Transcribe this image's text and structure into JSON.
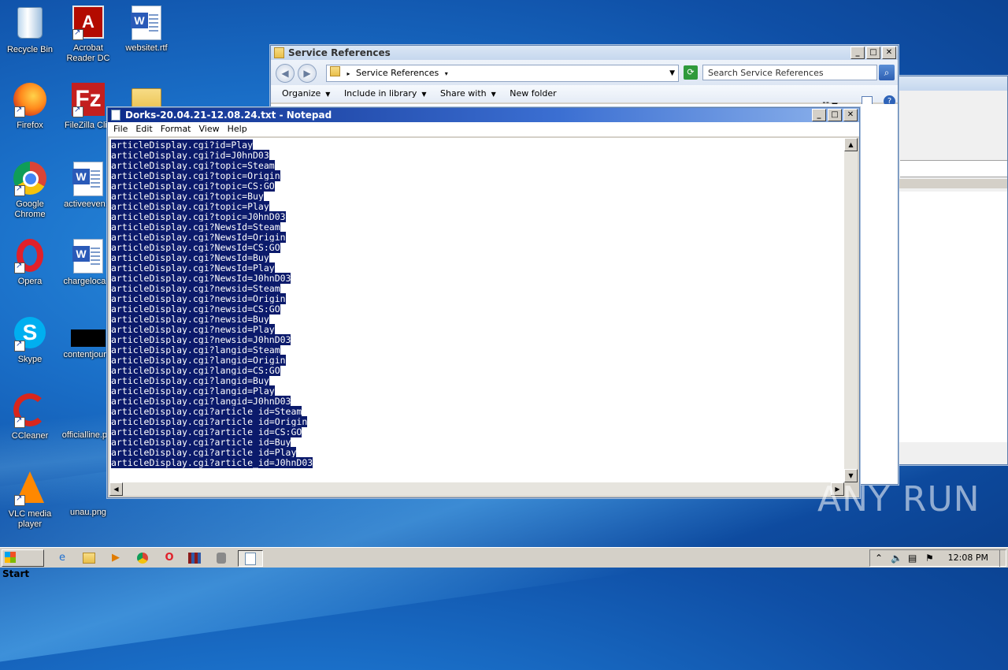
{
  "desktop": {
    "icons": [
      {
        "label": "Recycle Bin"
      },
      {
        "label": "Acrobat Reader DC"
      },
      {
        "label": "websitet.rtf"
      },
      {
        "label": "Firefox"
      },
      {
        "label": "FileZilla Clie"
      },
      {
        "label": "Google Chrome"
      },
      {
        "label": "activeeven..."
      },
      {
        "label": "Opera"
      },
      {
        "label": "chargeloca..."
      },
      {
        "label": "Skype"
      },
      {
        "label": "contentjour..."
      },
      {
        "label": "CCleaner"
      },
      {
        "label": "officialline.p..."
      },
      {
        "label": "VLC media player"
      },
      {
        "label": "unau.png"
      }
    ]
  },
  "explorer": {
    "title": "Service References",
    "address": "Service References",
    "search_placeholder": "Search Service References",
    "commands": [
      "Organize",
      "Include in library",
      "Share with",
      "New folder"
    ]
  },
  "notepad": {
    "title": "Dorks-20.04.21-12.08.24.txt - Notepad",
    "menu": [
      "File",
      "Edit",
      "Format",
      "View",
      "Help"
    ],
    "lines": [
      "articleDisplay.cgi?id=Play",
      "articleDisplay.cgi?id=J0hnD03",
      "articleDisplay.cgi?topic=Steam",
      "articleDisplay.cgi?topic=Origin",
      "articleDisplay.cgi?topic=CS:GO",
      "articleDisplay.cgi?topic=Buy",
      "articleDisplay.cgi?topic=Play",
      "articleDisplay.cgi?topic=J0hnD03",
      "articleDisplay.cgi?NewsId=Steam",
      "articleDisplay.cgi?NewsId=Origin",
      "articleDisplay.cgi?NewsId=CS:GO",
      "articleDisplay.cgi?NewsId=Buy",
      "articleDisplay.cgi?NewsId=Play",
      "articleDisplay.cgi?NewsId=J0hnD03",
      "articleDisplay.cgi?newsid=Steam",
      "articleDisplay.cgi?newsid=Origin",
      "articleDisplay.cgi?newsid=CS:GO",
      "articleDisplay.cgi?newsid=Buy",
      "articleDisplay.cgi?newsid=Play",
      "articleDisplay.cgi?newsid=J0hnD03",
      "articleDisplay.cgi?langid=Steam",
      "articleDisplay.cgi?langid=Origin",
      "articleDisplay.cgi?langid=CS:GO",
      "articleDisplay.cgi?langid=Buy",
      "articleDisplay.cgi?langid=Play",
      "articleDisplay.cgi?langid=J0hnD03",
      "articleDisplay.cgi?article_id=Steam",
      "articleDisplay.cgi?article_id=Origin",
      "articleDisplay.cgi?article_id=CS:GO",
      "articleDisplay.cgi?article_id=Buy",
      "articleDisplay.cgi?article_id=Play",
      "articleDisplay.cgi?article_id=J0hnD03"
    ]
  },
  "taskbar": {
    "start_label": "Start",
    "clock": "12:08 PM"
  },
  "watermark": "ANY RUN"
}
